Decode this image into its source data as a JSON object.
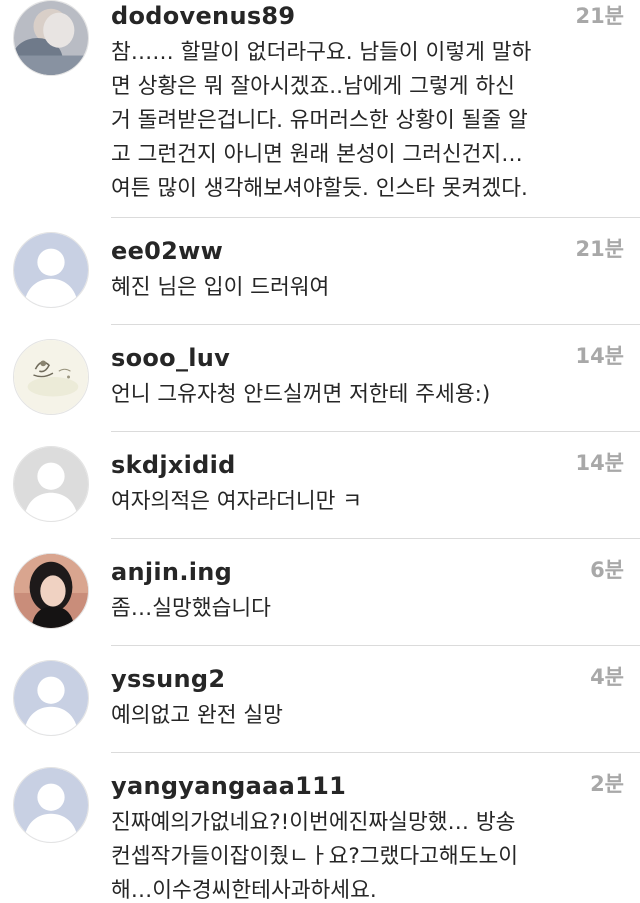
{
  "comments": [
    {
      "username": "dodovenus89",
      "time": "21분",
      "avatar": "photo-avatar-icon",
      "lines": [
        "참…… 할말이 없더라구요. 남들이 이렇게 말하",
        "면 상황은 뭐 잘아시겠죠..남에게 그렇게 하신",
        "거 돌려받은겁니다. 유머러스한 상황이 될줄 알",
        "고 그런건지 아니면 원래 본성이 그러신건지…",
        "여튼 많이 생각해보셔야할듯. 인스타 못켜겠다."
      ]
    },
    {
      "username": "ee02ww",
      "time": "21분",
      "avatar": "default-avatar-icon",
      "lines": [
        "혜진 님은 입이 드러워여"
      ]
    },
    {
      "username": "sooo_luv",
      "time": "14분",
      "avatar": "sketch-avatar-icon",
      "lines": [
        "언니 그유자청 안드실꺼면 저한테 주세용:)"
      ]
    },
    {
      "username": "skdjxidid",
      "time": "14분",
      "avatar": "default-avatar-icon",
      "lines": [
        "여자의적은 여자라더니만 ㅋ"
      ]
    },
    {
      "username": "anjin.ing",
      "time": "6분",
      "avatar": "photo-avatar-icon",
      "lines": [
        "좀…실망했습니다"
      ]
    },
    {
      "username": "yssung2",
      "time": "4분",
      "avatar": "default-avatar-icon",
      "lines": [
        "예의없고 완전 실망"
      ]
    },
    {
      "username": "yangyangaaa111",
      "time": "2분",
      "avatar": "default-avatar-icon",
      "lines": [
        "진짜예의가없네요?!이번에진짜실망했… 방송",
        "컨셉작가들이잡이줬ㄴㅏ요?그랬다고해도노이",
        "해…이수경씨한테사과하세요."
      ]
    }
  ]
}
